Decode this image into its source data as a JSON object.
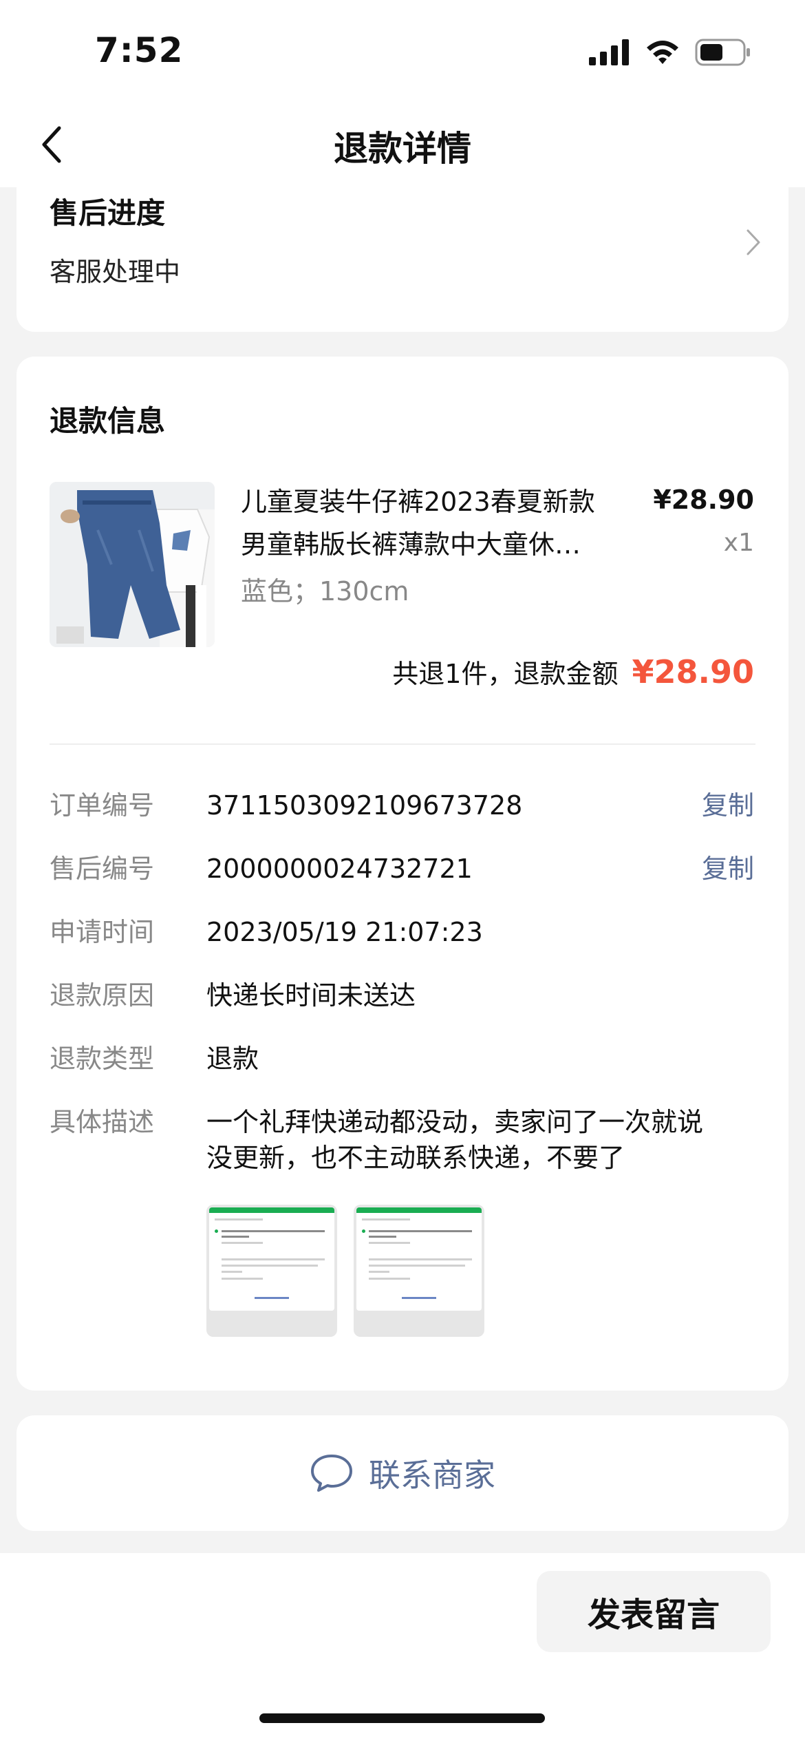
{
  "status_bar": {
    "time": "7:52"
  },
  "nav": {
    "title": "退款详情"
  },
  "progress": {
    "title": "售后进度",
    "status": "客服处理中"
  },
  "refund_info": {
    "title": "退款信息",
    "product": {
      "title_line1": "儿童夏装牛仔裤2023春夏新款",
      "title_line2": "男童韩版长裤薄款中大童休…",
      "price": "¥28.90",
      "qty": "x1",
      "spec": "蓝色；130cm"
    },
    "total_label": "共退1件，退款金额",
    "total_amount": "¥28.90",
    "rows": [
      {
        "key": "订单编号",
        "value": "3711503092109673728",
        "action": "复制"
      },
      {
        "key": "售后编号",
        "value": "2000000024732721",
        "action": "复制"
      },
      {
        "key": "申请时间",
        "value": "2023/05/19 21:07:23"
      },
      {
        "key": "退款原因",
        "value": "快递长时间未送达"
      },
      {
        "key": "退款类型",
        "value": "退款"
      },
      {
        "key": "具体描述",
        "value_line1": "一个礼拜快递动都没动，卖家问了一次就说",
        "value_line2": "没更新，也不主动联系快递，不要了"
      }
    ]
  },
  "contact": {
    "label": "联系商家"
  },
  "bottom": {
    "post_label": "发表留言"
  },
  "colors": {
    "accent_price": "#f4563c",
    "link": "#5a6e97",
    "page_bg": "#f3f3f3"
  }
}
